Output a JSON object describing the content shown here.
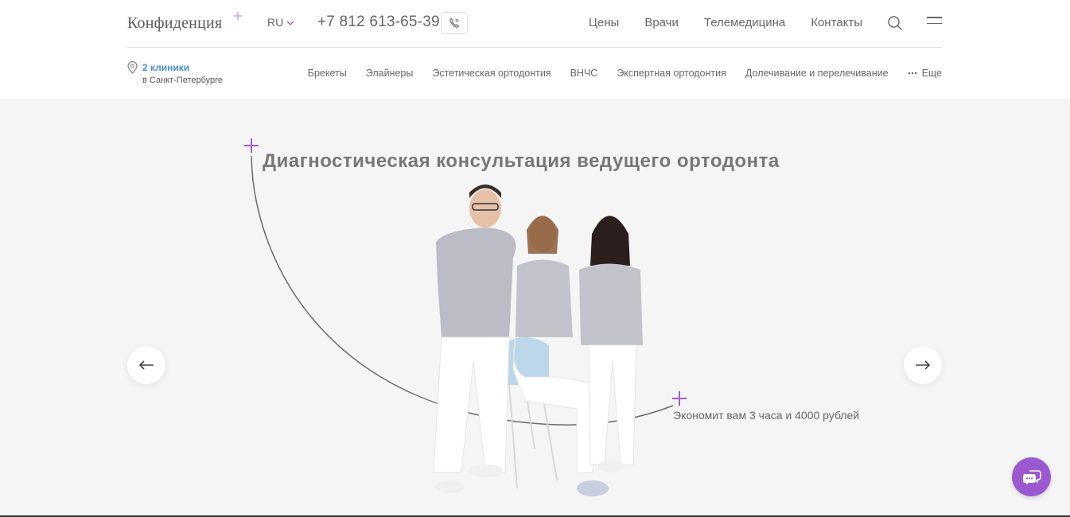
{
  "header": {
    "logo_text": "Конфиденция",
    "language": "RU",
    "phone": "+7 812 613-65-39",
    "nav": [
      "Цены",
      "Врачи",
      "Телемедицина",
      "Контакты"
    ],
    "clinics_count": "2 клиники",
    "clinics_city": "в Санкт-Петербурге",
    "services": [
      "Брекеты",
      "Элайнеры",
      "Эстетическая ортодонтия",
      "ВНЧС",
      "Экспертная ортодонтия",
      "Долечивание и перелечивание"
    ],
    "more_label": "Еще"
  },
  "hero": {
    "title": "Диагностическая консультация ведущего ортодонта",
    "subtitle": "Экономит вам 3 часа и 4000 рублей"
  },
  "colors": {
    "accent": "#9b59d0",
    "link": "#4a90c9",
    "hero_bg": "#f5f5f5"
  },
  "icons": [
    "logo-star-icon",
    "chevron-down-icon",
    "phone-callback-icon",
    "search-icon",
    "menu-icon",
    "location-pin-icon",
    "dots-icon",
    "arrow-left-icon",
    "arrow-right-icon",
    "chat-icon",
    "sparkle-icon"
  ]
}
